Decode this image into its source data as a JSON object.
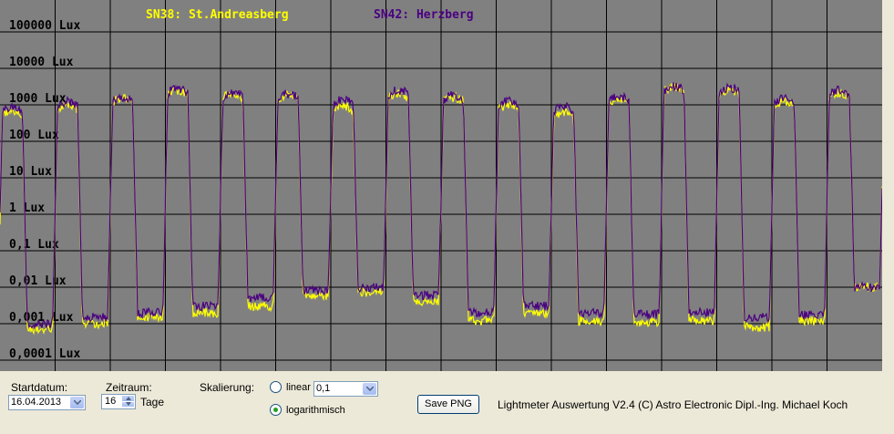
{
  "chart_data": {
    "type": "line",
    "ylabels": [
      "100000 Lux",
      "10000 Lux",
      "1000 Lux",
      "100 Lux",
      "10 Lux",
      "1 Lux",
      "0,1 Lux",
      "0,01 Lux",
      "0,001 Lux",
      "0,0001 Lux"
    ],
    "ylog": true,
    "ylim": [
      0.0001,
      100000
    ],
    "grid": true,
    "legend_position": "top-center",
    "days": 16,
    "series": [
      {
        "name": "SN38: St.Andreasberg",
        "color": "#FFFF00",
        "night": [
          0.0007,
          0.001,
          0.0015,
          0.002,
          0.003,
          0.006,
          0.007,
          0.004,
          0.0012,
          0.002,
          0.0012,
          0.0011,
          0.0012,
          0.0008,
          0.0012,
          0.01
        ],
        "peak": [
          700,
          1000,
          1500,
          2500,
          2000,
          1800,
          900,
          2000,
          1600,
          1000,
          600,
          1500,
          3000,
          2500,
          1200,
          2200
        ]
      },
      {
        "name": "SN42: Herzberg",
        "color": "#4B0082",
        "night": [
          0.001,
          0.0015,
          0.002,
          0.003,
          0.005,
          0.008,
          0.01,
          0.006,
          0.002,
          0.003,
          0.002,
          0.0018,
          0.002,
          0.0015,
          0.0018,
          0.01
        ],
        "peak": [
          800,
          1200,
          1600,
          2800,
          2200,
          2000,
          1400,
          2500,
          1800,
          1300,
          900,
          1700,
          3200,
          3000,
          1500,
          2500
        ]
      }
    ]
  },
  "controls": {
    "start_label": "Startdatum:",
    "start_value": "16.04.2013",
    "range_label": "Zeitraum:",
    "range_value": "16",
    "range_unit": "Tage",
    "scale_label": "Skalierung:",
    "linear_label": "linear",
    "linear_value": "0,1",
    "log_label": "logarithmisch",
    "save_label": "Save PNG",
    "credit": "Lightmeter Auswertung V2.4  (C) Astro Electronic Dipl.-Ing. Michael Koch"
  },
  "colors": {
    "plot_bg": "#808080",
    "grid": "#000000",
    "window_bg": "#ECE9D8"
  }
}
